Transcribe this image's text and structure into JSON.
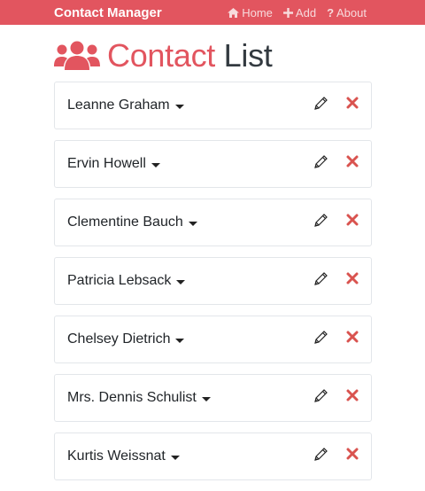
{
  "navbar": {
    "brand": "Contact Manager",
    "links": [
      {
        "label": "Home",
        "icon": "home-icon"
      },
      {
        "label": "Add",
        "icon": "plus-icon"
      },
      {
        "label": "About",
        "icon": "question-icon"
      }
    ],
    "background": "#e2555f"
  },
  "heading": {
    "accent": "Contact",
    "rest": "List",
    "icon": "users-icon",
    "accent_color": "#e2555f"
  },
  "contacts": [
    {
      "name": "Leanne Graham"
    },
    {
      "name": "Ervin Howell"
    },
    {
      "name": "Clementine Bauch"
    },
    {
      "name": "Patricia Lebsack"
    },
    {
      "name": "Chelsey Dietrich"
    },
    {
      "name": "Mrs. Dennis Schulist"
    },
    {
      "name": "Kurtis Weissnat"
    }
  ],
  "icons": {
    "edit": "pencil-icon",
    "delete": "times-icon",
    "toggle": "caret-down-icon"
  },
  "delete_color": "#d9534f"
}
